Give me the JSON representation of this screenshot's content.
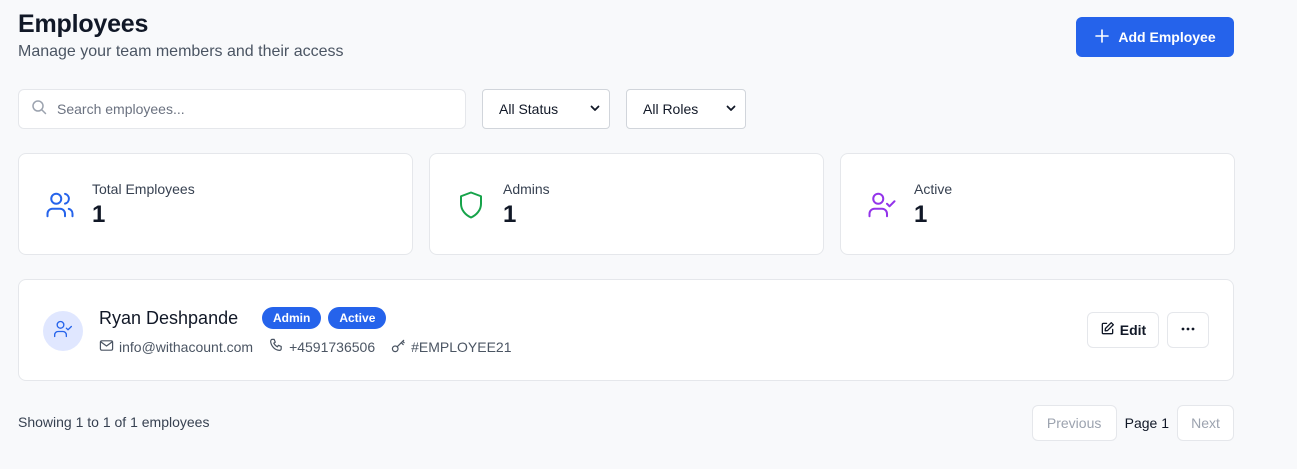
{
  "header": {
    "title": "Employees",
    "subtitle": "Manage your team members and their access",
    "add_button_label": "Add Employee"
  },
  "filters": {
    "search_placeholder": "Search employees...",
    "status_selected": "All Status",
    "roles_selected": "All Roles"
  },
  "stats": [
    {
      "label": "Total Employees",
      "value": "1",
      "icon": "users-icon",
      "color": "#2563eb"
    },
    {
      "label": "Admins",
      "value": "1",
      "icon": "shield-icon",
      "color": "#16a34a"
    },
    {
      "label": "Active",
      "value": "1",
      "icon": "user-check-icon",
      "color": "#9333ea"
    }
  ],
  "employees": [
    {
      "name": "Ryan Deshpande",
      "badges": [
        "Admin",
        "Active"
      ],
      "email": "info@withacount.com",
      "phone": "+4591736506",
      "employee_id": "#EMPLOYEE21",
      "edit_label": "Edit"
    }
  ],
  "footer": {
    "showing_text": "Showing 1 to 1 of 1 employees",
    "previous_label": "Previous",
    "page_label": "Page 1",
    "next_label": "Next"
  },
  "colors": {
    "accent": "#2563eb",
    "background": "#f8f9fb"
  }
}
